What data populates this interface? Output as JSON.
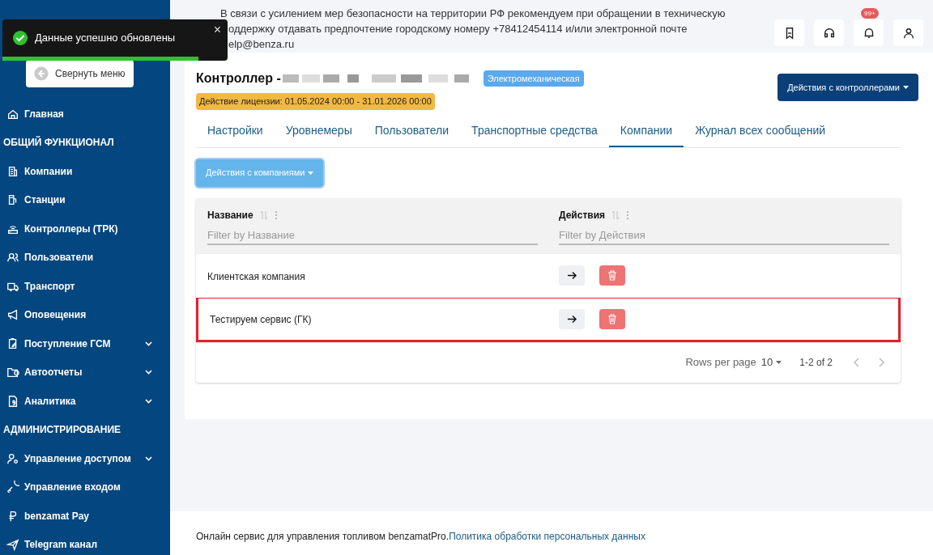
{
  "toast": {
    "message": "Данные успешно обновлены",
    "close": "×",
    "level": 0.87
  },
  "sidebar": {
    "collapse_button": "Свернуть меню",
    "items": [
      {
        "kind": "item",
        "label": "Главная",
        "expandable": false
      },
      {
        "kind": "section",
        "label": "ОБЩИЙ ФУНКЦИОНАЛ"
      },
      {
        "kind": "item",
        "label": "Компании",
        "expandable": false
      },
      {
        "kind": "item",
        "label": "Станции",
        "expandable": false
      },
      {
        "kind": "item",
        "label": "Контроллеры (ТРК)",
        "expandable": false
      },
      {
        "kind": "item",
        "label": "Пользователи",
        "expandable": false
      },
      {
        "kind": "item",
        "label": "Транспорт",
        "expandable": false
      },
      {
        "kind": "item",
        "label": "Оповещения",
        "expandable": false
      },
      {
        "kind": "item",
        "label": "Поступление ГСМ",
        "expandable": true
      },
      {
        "kind": "item",
        "label": "Автоотчеты",
        "expandable": true
      },
      {
        "kind": "item",
        "label": "Аналитика",
        "expandable": true
      },
      {
        "kind": "section",
        "label": "АДМИНИСТРИРОВАНИЕ"
      },
      {
        "kind": "item",
        "label": "Управление доступом",
        "expandable": true
      },
      {
        "kind": "item",
        "label": "Управление входом",
        "expandable": false
      },
      {
        "kind": "item",
        "label": "benzamat Pay",
        "expandable": false
      },
      {
        "kind": "item",
        "label": "Telegram канал",
        "expandable": false
      }
    ]
  },
  "notice": [
    "В связи с усилением мер безопасности на территории РФ рекомендуем при обращении в техническую",
    "оддержку отдавать предпочтение городскому номеру +78412454114 и/или электронной почте",
    "elp@benza.ru"
  ],
  "header_icons": {
    "notification_badge": "99+"
  },
  "controller": {
    "title": "Контроллер -",
    "type_badge": "Электромеханическая",
    "license": "Действие лицензии: 01.05.2024 00:00 - 31.01.2026 00:00",
    "actions_button": "Действия с контроллерами"
  },
  "tabs": [
    {
      "label": "Настройки",
      "selected": false
    },
    {
      "label": "Уровнемеры",
      "selected": false
    },
    {
      "label": "Пользователи",
      "selected": false
    },
    {
      "label": "Транспортные средства",
      "selected": false
    },
    {
      "label": "Компании",
      "selected": true
    },
    {
      "label": "Журнал всех сообщений",
      "selected": false
    }
  ],
  "companies_button": "Действия с компаниями",
  "table": {
    "columns": [
      {
        "label": "Название",
        "placeholder": "Filter by Название"
      },
      {
        "label": "Действия",
        "placeholder": "Filter by Действия"
      }
    ],
    "rows": [
      {
        "name": "Клиентская компания",
        "highlighted": false
      },
      {
        "name": "Тестируем сервис (ГК)",
        "highlighted": true
      }
    ],
    "pagination": {
      "rows_per_page_label": "Rows per page",
      "rows_per_page": "10",
      "range": "1-2 of 2"
    }
  },
  "footer": {
    "text": "Онлайн сервис для управления топливом benzamatPro.",
    "link": "Политика обработки персональных данных"
  }
}
